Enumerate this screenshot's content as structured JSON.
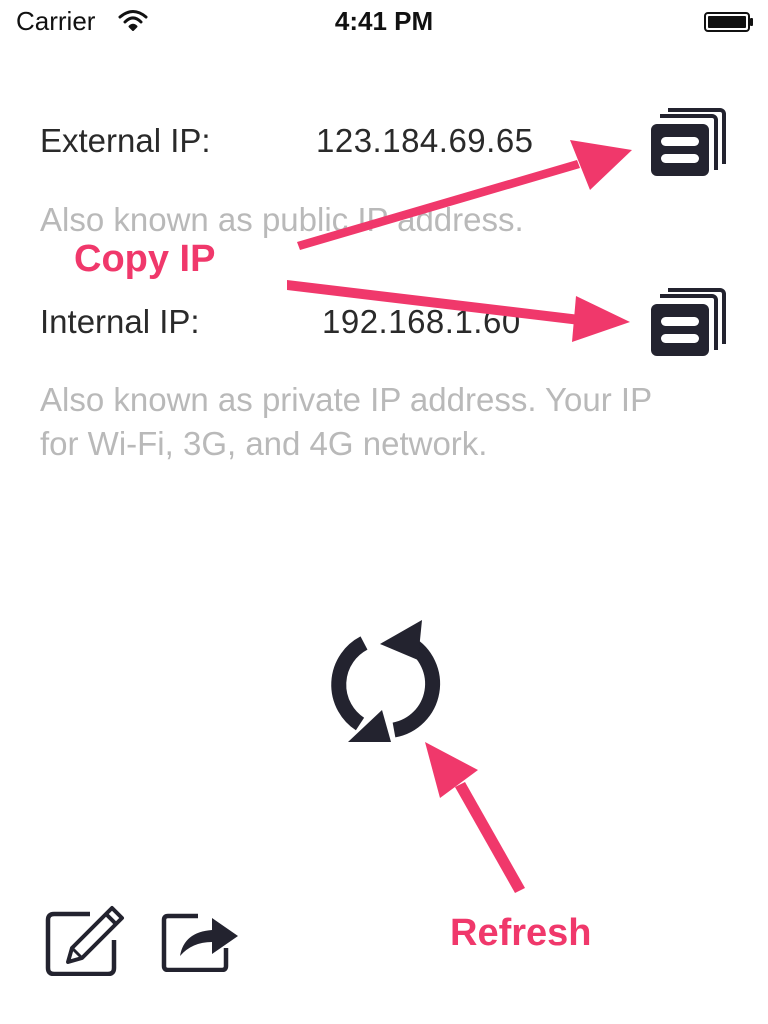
{
  "status_bar": {
    "carrier": "Carrier",
    "time": "4:41 PM",
    "wifi_icon": "wifi-icon",
    "battery_icon": "battery-icon"
  },
  "external": {
    "label": "External IP:",
    "value": "123.184.69.65",
    "description": "Also known as public IP address.",
    "copy_icon": "copy-icon"
  },
  "internal": {
    "label": "Internal IP:",
    "value": "192.168.1.60",
    "description": "Also known as private IP address. Your IP for Wi-Fi, 3G, and 4G network.",
    "copy_icon": "copy-icon"
  },
  "toolbar": {
    "refresh_icon": "refresh-icon",
    "edit_icon": "edit-icon",
    "share_icon": "share-icon"
  },
  "annotations": {
    "copy_ip": "Copy IP",
    "refresh": "Refresh",
    "color": "#f0386b"
  },
  "colors": {
    "icon": "#23232f",
    "text": "#2a2a2a",
    "muted_text": "#b9b9b9",
    "background": "#ffffff"
  }
}
